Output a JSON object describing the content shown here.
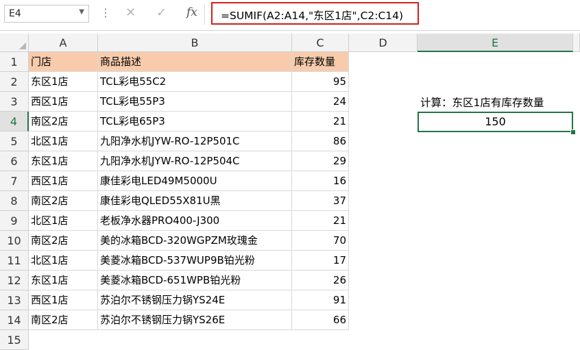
{
  "formula_bar": {
    "name_box": "E4",
    "cancel_icon": "✕",
    "enter_icon": "✓",
    "fx_label": "fx",
    "formula": "=SUMIF(A2:A14,\"东区1店\",C2:C14)"
  },
  "columns": [
    "A",
    "B",
    "C",
    "D",
    "E"
  ],
  "rows": [
    "1",
    "2",
    "3",
    "4",
    "5",
    "6",
    "7",
    "8",
    "9",
    "10",
    "11",
    "12",
    "13",
    "14",
    "15"
  ],
  "table": {
    "headers": [
      "门店",
      "商品描述",
      "库存数量"
    ],
    "rows": [
      [
        "东区1店",
        "TCL彩电55C2",
        "95"
      ],
      [
        "西区1店",
        "TCL彩电55P3",
        "24"
      ],
      [
        "南区2店",
        "TCL彩电65P3",
        "21"
      ],
      [
        "北区1店",
        "九阳净水机JYW-RO-12P501C",
        "86"
      ],
      [
        "东区1店",
        "九阳净水机JYW-RO-12P504C",
        "29"
      ],
      [
        "西区1店",
        "康佳彩电LED49M5000U",
        "16"
      ],
      [
        "南区2店",
        "康佳彩电QLED55X81U黑",
        "37"
      ],
      [
        "北区1店",
        "老板净水器PRO400-J300",
        "21"
      ],
      [
        "南区2店",
        "美的冰箱BCD-320WGPZM玫瑰金",
        "70"
      ],
      [
        "北区1店",
        "美菱冰箱BCD-537WUP9B铂光粉",
        "17"
      ],
      [
        "东区1店",
        "美菱冰箱BCD-651WPB铂光粉",
        "26"
      ],
      [
        "西区1店",
        "苏泊尔不锈钢压力锅YS24E",
        "91"
      ],
      [
        "南区2店",
        "苏泊尔不锈钢压力锅YS26E",
        "66"
      ]
    ]
  },
  "calc": {
    "label": "计算：东区1店有库存数量",
    "result": "150"
  },
  "colors": {
    "header_fill": "#f8cbad",
    "selection": "#217346",
    "formula_highlight": "#d11f1f"
  }
}
